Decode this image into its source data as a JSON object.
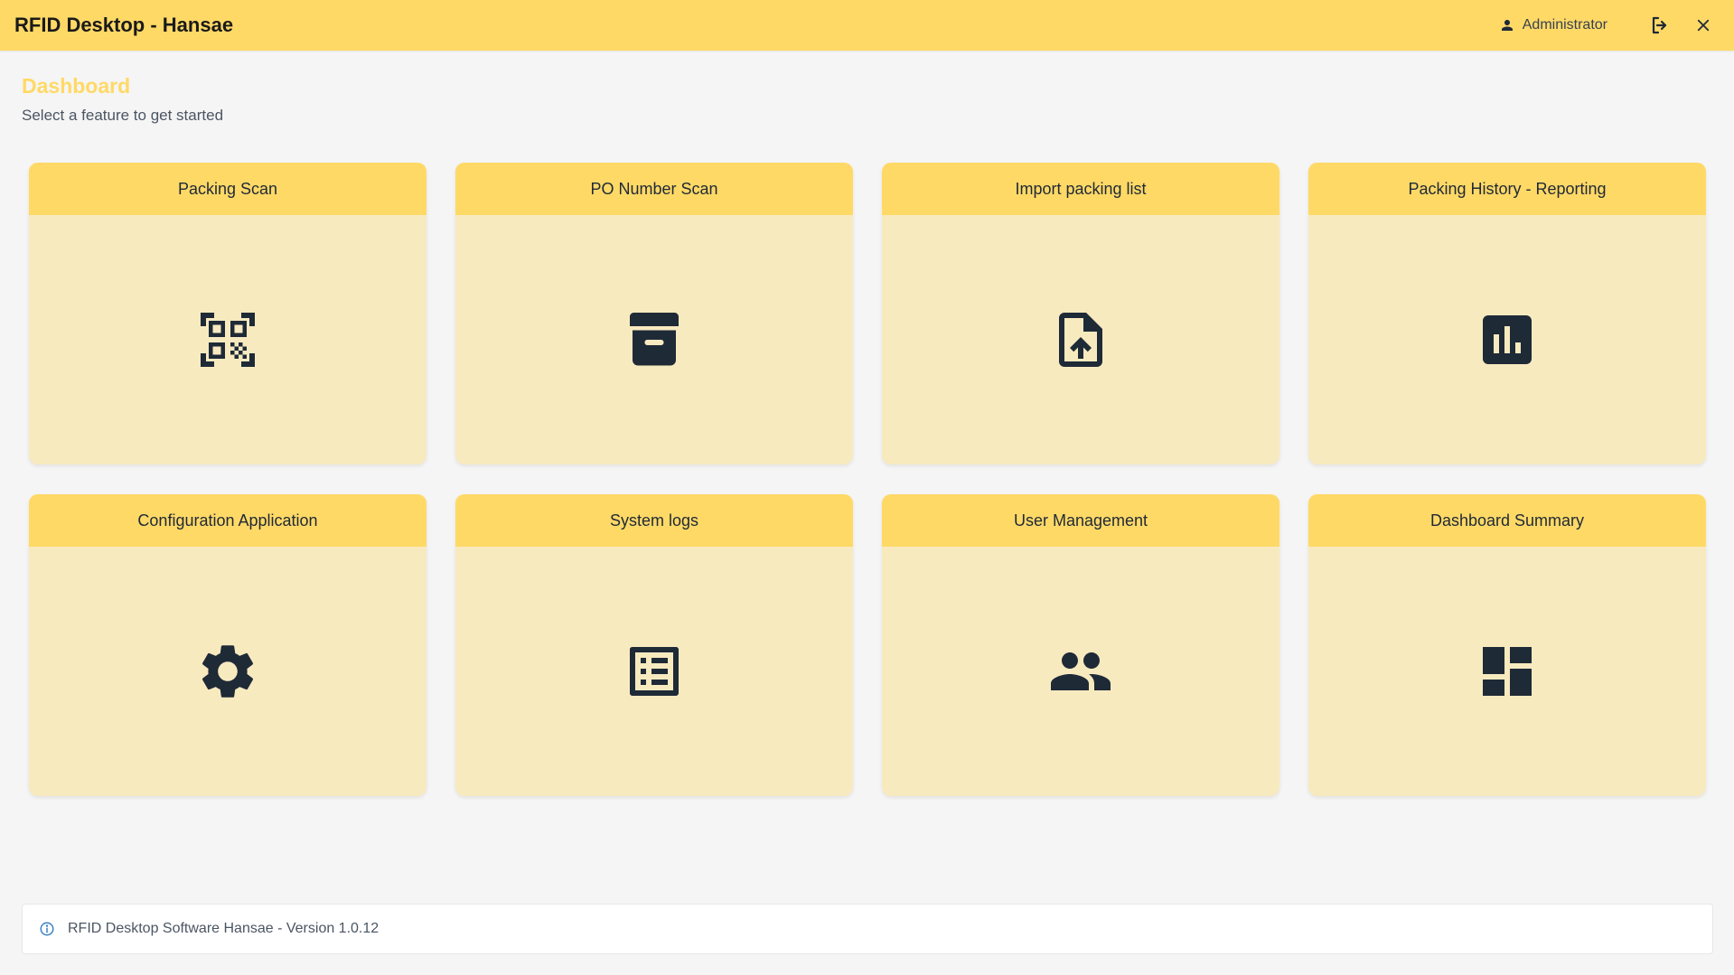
{
  "window": {
    "title": "RFID Desktop - Hansae",
    "user": "Administrator"
  },
  "icons": {
    "user": "person-icon",
    "logout": "logout-icon",
    "close": "close-icon",
    "info": "info-icon"
  },
  "colors": {
    "accent": "#ffd966",
    "card_body": "#f8eabf",
    "icon": "#1f2a37",
    "background": "#f5f5f5"
  },
  "header": {
    "title": "Dashboard",
    "subtitle": "Select a feature to get started"
  },
  "cards": [
    {
      "label": "Packing Scan",
      "icon": "qr-code-scanner-icon"
    },
    {
      "label": "PO Number Scan",
      "icon": "archive-box-icon"
    },
    {
      "label": "Import packing list",
      "icon": "file-upload-icon"
    },
    {
      "label": "Packing History - Reporting",
      "icon": "bar-chart-icon"
    },
    {
      "label": "Configuration Application",
      "icon": "gear-icon"
    },
    {
      "label": "System logs",
      "icon": "list-icon"
    },
    {
      "label": "User Management",
      "icon": "people-icon"
    },
    {
      "label": "Dashboard Summary",
      "icon": "dashboard-icon"
    }
  ],
  "footer": {
    "text": "RFID Desktop Software Hansae - Version 1.0.12"
  }
}
